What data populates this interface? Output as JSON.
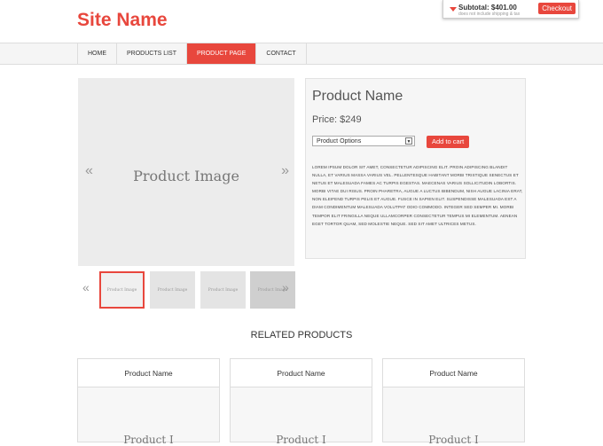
{
  "header": {
    "site_name": "Site Name"
  },
  "cart": {
    "subtotal": "Subtotal: $401.00",
    "note": "does not include shipping & tax",
    "checkout_label": "Checkout"
  },
  "nav": {
    "items": [
      {
        "label": "HOME"
      },
      {
        "label": "PRODUCTS LIST"
      },
      {
        "label": "PRODUCT PAGE"
      },
      {
        "label": "CONTACT"
      }
    ],
    "active": "PRODUCT PAGE"
  },
  "gallery": {
    "main_image_label": "Product Image",
    "prev_glyph": "«",
    "next_glyph": "»",
    "thumbnails": [
      {
        "label": "Product Image"
      },
      {
        "label": "Product Image"
      },
      {
        "label": "Product Image"
      },
      {
        "label": "Product Image"
      }
    ]
  },
  "product": {
    "name": "Product Name",
    "price": "Price: $249",
    "options_select": "Product Options",
    "add_to_cart_label": "Add to cart",
    "description": "LOREM IPSUM DOLOR SIT AMET, CONSECTETUR ADIPISCING ELIT. PROIN ADIPISCING BLANDIT NULLA, ET VARIUS MASSA VARIUS VEL. PELLENTESQUE HABITANT MORBI TRISTIQUE SENECTUS ET NETUS ET MALESUADA FAMES AC TURPIS EGESTAS. MAECENAS VARIUS SOLLICITUDIN LOBORTIS. MORBI VITAE DUI RISUS. PROIN PHARETRA, AUGUE A LUCTUS BIBENDUM, NISH AUGUE LACINIA ERAT, NON ELEIFEND TURPIS PELIS ET AUGUE. FUSCE IN SAPIEN ELIT. SUSPENDISSE MALESUADA EST A DIAM CONDIMENTUM MALESUADA VOLUTPAT ODIO COMMODO. INTEGER SED SEMPER MI. MORBI TEMPOR ELIT FRINGILLA NEQUE ULLAMCORPER CONSECTETUR TEMPUS MI ELEMENTUM. AENEAN EGET TORTOR QUAM, SED MOLESTIE NEQUE. SED SIT AMET ULTRICES METUS."
  },
  "related": {
    "title": "RELATED PRODUCTS",
    "cards": [
      {
        "name": "Product Name",
        "image_label": "Product I"
      },
      {
        "name": "Product Name",
        "image_label": "Product I"
      },
      {
        "name": "Product Name",
        "image_label": "Product I"
      }
    ]
  },
  "colors": {
    "accent": "#e8473d",
    "nav_bg": "#f5f5f5",
    "image_placeholder": "#ececec"
  }
}
